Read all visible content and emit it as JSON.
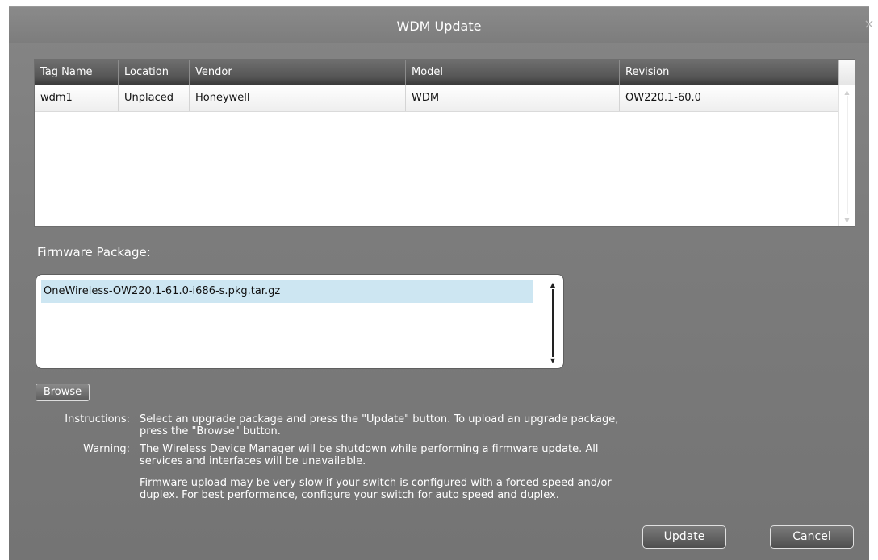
{
  "dialog": {
    "title": "WDM Update",
    "close_glyph": "×"
  },
  "table": {
    "columns": [
      "Tag Name",
      "Location",
      "Vendor",
      "Model",
      "Revision"
    ],
    "rows": [
      [
        "wdm1",
        "Unplaced",
        "Honeywell",
        "WDM",
        "OW220.1-60.0"
      ]
    ]
  },
  "firmware": {
    "label": "Firmware Package:",
    "items": [
      "OneWireless-OW220.1-61.0-i686-s.pkg.tar.gz"
    ],
    "browse_label": "Browse"
  },
  "info": {
    "instructions_label": "Instructions:",
    "instructions_text": "Select an upgrade package and press the \"Update\" button. To upload an upgrade package, press the \"Browse\" button.",
    "warning_label": "Warning:",
    "warning_text": "The Wireless Device Manager will be shutdown while performing a firmware update. All services and interfaces will be unavailable.",
    "warning_note": "Firmware upload may be very slow if your switch is configured with a forced speed and/or duplex. For best performance, configure your switch for auto speed and duplex."
  },
  "actions": {
    "update_label": "Update",
    "cancel_label": "Cancel"
  }
}
